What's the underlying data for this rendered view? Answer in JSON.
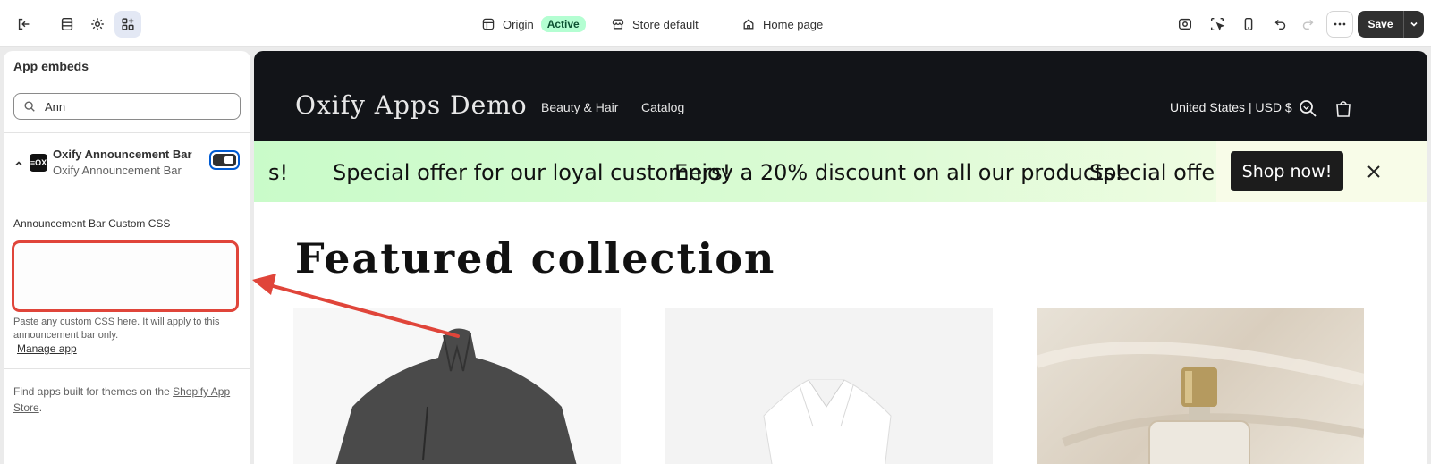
{
  "topbar": {
    "origin_label": "Origin",
    "active_badge": "Active",
    "store_label": "Store default",
    "page_label": "Home page",
    "save_label": "Save"
  },
  "sidebar": {
    "title": "App embeds",
    "search_value": "Ann",
    "app": {
      "name": "Oxify Announcement Bar",
      "subtitle": "Oxify Announcement Bar",
      "icon_text": "≡OX",
      "enabled": true
    },
    "css_field": {
      "label": "Announcement Bar Custom CSS",
      "value": "",
      "help": "Paste any custom CSS here. It will apply to this announcement bar only."
    },
    "manage_link": "Manage app",
    "footer_prefix": "Find apps built for themes on the ",
    "footer_link": "Shopify App Store",
    "footer_suffix": "."
  },
  "preview": {
    "logo": "Oxify Apps Demo",
    "nav": [
      "Beauty & Hair",
      "Catalog"
    ],
    "currency": "United States | USD $",
    "announcement": {
      "fragment": "s!",
      "message1": "Special offer for our loyal customers!",
      "message2": "Enjoy a 20% discount on all our products!",
      "message3": "Special offer fo",
      "button": "Shop now!"
    },
    "section_title": "Featured collection"
  },
  "colors": {
    "accent": "#005bd3",
    "highlight": "#e0453a",
    "store_header": "#121418"
  }
}
